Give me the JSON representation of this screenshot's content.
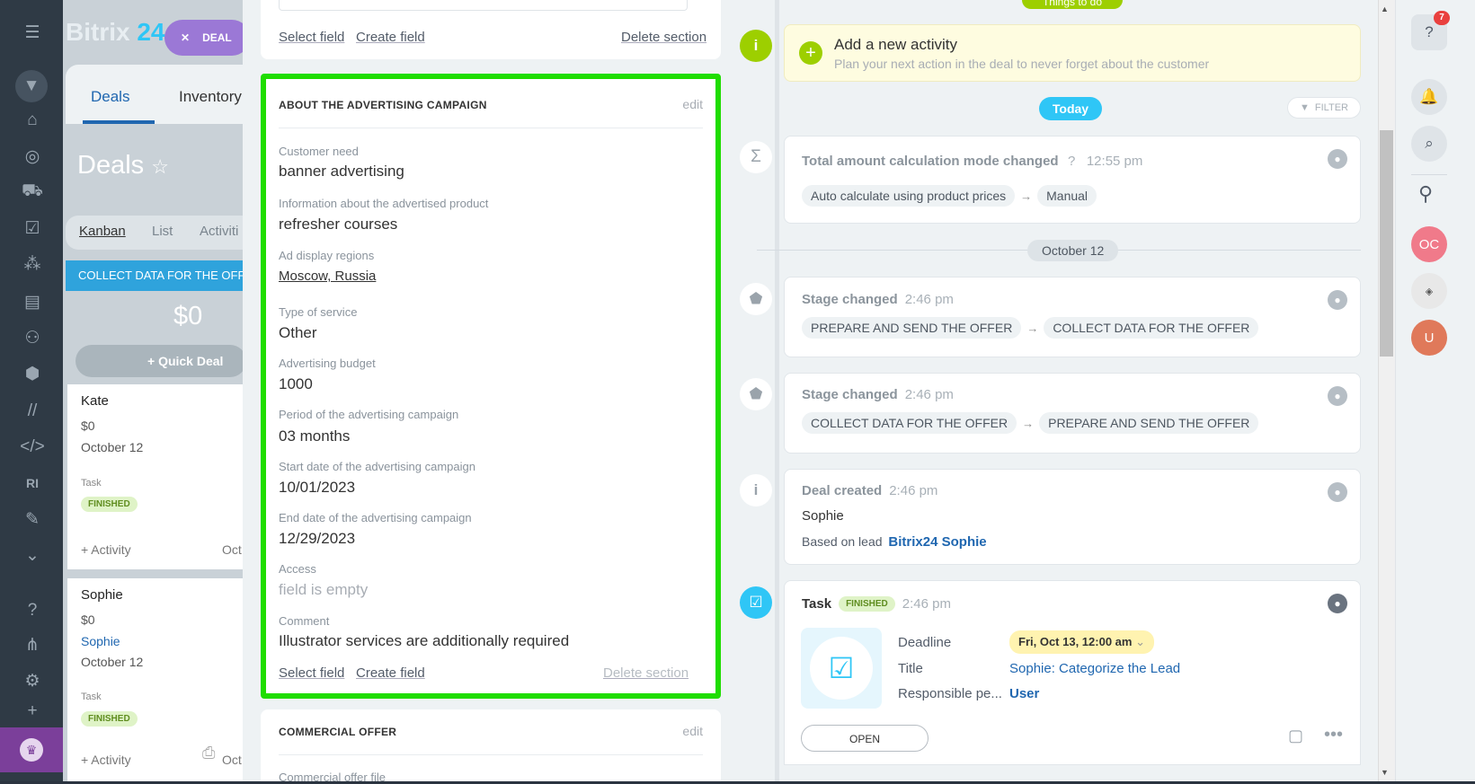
{
  "app": {
    "logo_a": "Bitrix",
    "logo_b": " 24",
    "deal_pill": "DEAL"
  },
  "crm_bg": {
    "tabs": [
      "Deals",
      "Inventory"
    ],
    "page_title": "Deals",
    "view_tabs": [
      "Kanban",
      "List",
      "Activiti"
    ],
    "column_header": "COLLECT DATA FOR THE OFFER",
    "column_sum": "$0",
    "quick_deal": "+ Quick Deal",
    "cards": [
      {
        "name": "Kate",
        "sum": "$0",
        "date": "October 12",
        "label": "Task",
        "badge": "FINISHED",
        "activity": "+ Activity",
        "extra": "Oct"
      },
      {
        "name": "Sophie",
        "sum": "$0",
        "contact": "Sophie",
        "date": "October 12",
        "label": "Task",
        "badge": "FINISHED",
        "activity": "+ Activity",
        "extra": "Oct"
      }
    ]
  },
  "leftnav": {
    "ri": "RI"
  },
  "top_section": {
    "select_field": "Select field",
    "create_field": "Create field",
    "delete_section": "Delete section"
  },
  "ad_section": {
    "title": "ABOUT THE ADVERTISING CAMPAIGN",
    "edit": "edit",
    "fields": [
      {
        "label": "Customer need",
        "value": "banner advertising"
      },
      {
        "label": "Information about the advertised product",
        "value": "refresher courses"
      },
      {
        "label": "Ad display regions",
        "value": "Moscow, Russia"
      },
      {
        "label": "Type of service",
        "value": "Other"
      },
      {
        "label": "Advertising budget",
        "value": "1000"
      },
      {
        "label": "Period of the advertising campaign",
        "value": "03 months"
      },
      {
        "label": "Start date of the advertising campaign",
        "value": "10/01/2023"
      },
      {
        "label": "End date of the advertising campaign",
        "value": "12/29/2023"
      },
      {
        "label": "Access",
        "value": "field is empty"
      },
      {
        "label": "Comment",
        "value": "Illustrator services are additionally required"
      }
    ],
    "select_field": "Select field",
    "create_field": "Create field",
    "delete_section": "Delete section"
  },
  "offer_section": {
    "title": "COMMERCIAL OFFER",
    "edit": "edit",
    "first_field": "Commercial offer file"
  },
  "timeline": {
    "things_to_do": "Things to do",
    "add_activity": {
      "title": "Add a new activity",
      "subtitle": "Plan your next action in the deal to never forget about the customer"
    },
    "today": "Today",
    "filter": "FILTER",
    "items": [
      {
        "title": "Total amount calculation mode changed",
        "time": "12:55 pm",
        "from": "Auto calculate using product prices",
        "to": "Manual"
      },
      {
        "title": "Stage changed",
        "time": "2:46 pm",
        "from": "PREPARE AND SEND THE OFFER",
        "to": "COLLECT DATA FOR THE OFFER"
      },
      {
        "title": "Stage changed",
        "time": "2:46 pm",
        "from": "COLLECT DATA FOR THE OFFER",
        "to": "PREPARE AND SEND THE OFFER"
      },
      {
        "title": "Deal created",
        "time": "2:46 pm",
        "name": "Sophie",
        "based_on": "Based on lead",
        "lead_link": "Bitrix24 Sophie"
      }
    ],
    "date_divider": "October 12",
    "task": {
      "title": "Task",
      "badge": "FINISHED",
      "time": "2:46 pm",
      "deadline_label": "Deadline",
      "deadline_value": "Fri, Oct 13, 12:00 am",
      "title_label": "Title",
      "title_value": "Sophie: Categorize the Lead",
      "resp_label": "Responsible pe...",
      "resp_value": "User",
      "open_button": "OPEN"
    }
  },
  "rail": {
    "notif_count": "7",
    "avatar1": "OC",
    "avatar3": "U"
  },
  "colors": {
    "accent": "#2fc6f6",
    "highlight": "#1fdd00",
    "link": "#2067b0"
  }
}
